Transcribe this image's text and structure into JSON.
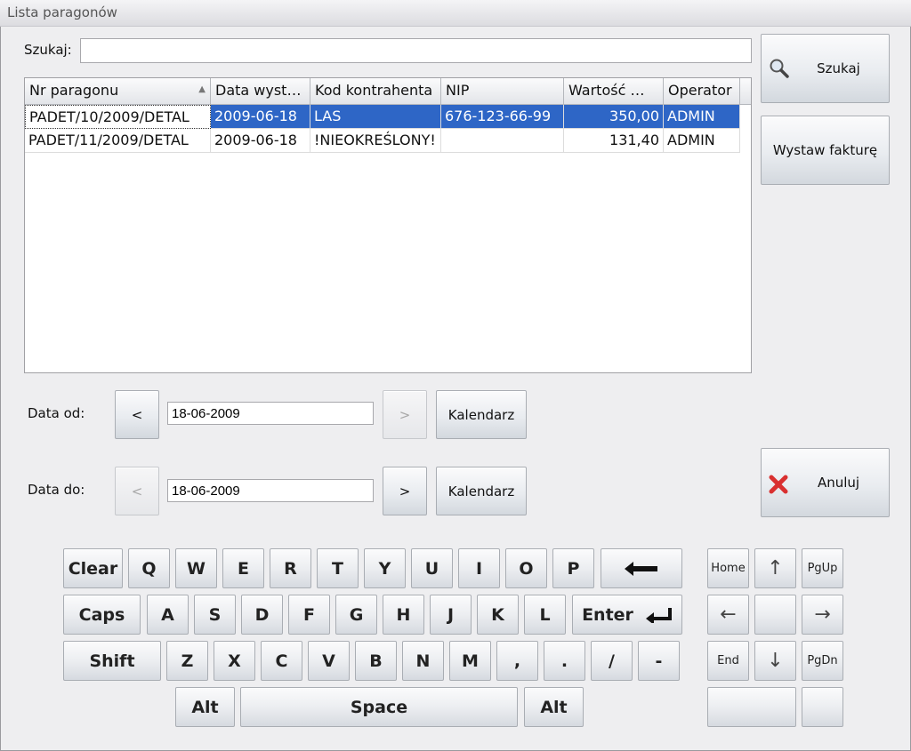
{
  "window": {
    "title": "Lista paragonów"
  },
  "search": {
    "label": "Szukaj:",
    "value": "",
    "button": "Szukaj"
  },
  "actions": {
    "invoice": "Wystaw fakturę",
    "cancel": "Anuluj"
  },
  "table": {
    "columns": [
      "Nr paragonu",
      "Data wyst…",
      "Kod kontrahenta",
      "NIP",
      "Wartość …",
      "Operator"
    ],
    "rows": [
      [
        "PADET/10/2009/DETAL",
        "2009-06-18",
        "LAS",
        "676-123-66-99",
        "350,00",
        "ADMIN"
      ],
      [
        "PADET/11/2009/DETAL",
        "2009-06-18",
        "!NIEOKREŚLONY!",
        "",
        "131,40",
        "ADMIN"
      ]
    ]
  },
  "date_from": {
    "label": "Data od:",
    "value": "18-06-2009",
    "prev": "<",
    "next": ">",
    "calendar": "Kalendarz"
  },
  "date_to": {
    "label": "Data do:",
    "value": "18-06-2009",
    "prev": "<",
    "next": ">",
    "calendar": "Kalendarz"
  },
  "keyboard": {
    "row1": [
      "Q",
      "W",
      "E",
      "R",
      "T",
      "Y",
      "U",
      "I",
      "O",
      "P"
    ],
    "row2": [
      "A",
      "S",
      "D",
      "F",
      "G",
      "H",
      "J",
      "K",
      "L"
    ],
    "row3": [
      "Z",
      "X",
      "C",
      "V",
      "B",
      "N",
      "M",
      ",",
      ".",
      "/",
      "-"
    ],
    "clear": "Clear",
    "caps": "Caps",
    "shift": "Shift",
    "enter": "Enter",
    "alt": "Alt",
    "space": "Space",
    "home": "Home",
    "end": "End",
    "pgup": "PgUp",
    "pgdn": "PgDn",
    "up": "↑",
    "down": "↓",
    "left": "←",
    "right": "→"
  },
  "colors": {
    "selection": "#2e66c6",
    "cancel_icon": "#d93030"
  }
}
